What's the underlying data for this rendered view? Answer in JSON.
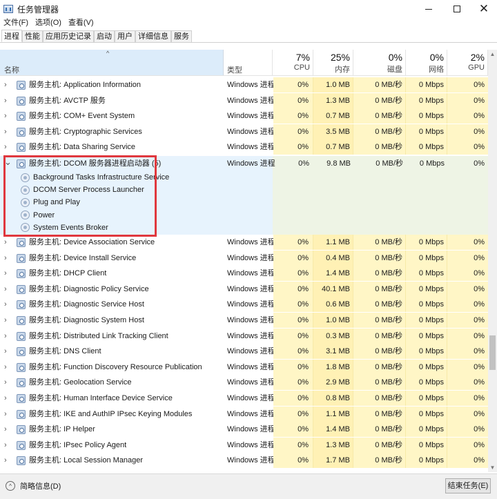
{
  "window": {
    "title": "任务管理器"
  },
  "menu": [
    "文件(F)",
    "选项(O)",
    "查看(V)"
  ],
  "tabs": [
    "进程",
    "性能",
    "应用历史记录",
    "启动",
    "用户",
    "详细信息",
    "服务"
  ],
  "header": {
    "name": "名称",
    "type": "类型",
    "columns": [
      {
        "pct": "7%",
        "label": "CPU"
      },
      {
        "pct": "25%",
        "label": "内存"
      },
      {
        "pct": "0%",
        "label": "磁盘"
      },
      {
        "pct": "0%",
        "label": "网络"
      },
      {
        "pct": "2%",
        "label": "GPU"
      }
    ]
  },
  "rows_top": [
    {
      "name": "服务主机: Application Information",
      "type": "Windows 进程",
      "cpu": "0%",
      "mem": "1.0 MB",
      "disk": "0 MB/秒",
      "net": "0 Mbps",
      "gpu": "0%"
    },
    {
      "name": "服务主机: AVCTP 服务",
      "type": "Windows 进程",
      "cpu": "0%",
      "mem": "1.3 MB",
      "disk": "0 MB/秒",
      "net": "0 Mbps",
      "gpu": "0%"
    },
    {
      "name": "服务主机: COM+ Event System",
      "type": "Windows 进程",
      "cpu": "0%",
      "mem": "0.7 MB",
      "disk": "0 MB/秒",
      "net": "0 Mbps",
      "gpu": "0%"
    },
    {
      "name": "服务主机: Cryptographic Services",
      "type": "Windows 进程",
      "cpu": "0%",
      "mem": "3.5 MB",
      "disk": "0 MB/秒",
      "net": "0 Mbps",
      "gpu": "0%"
    },
    {
      "name": "服务主机: Data Sharing Service",
      "type": "Windows 进程",
      "cpu": "0%",
      "mem": "0.7 MB",
      "disk": "0 MB/秒",
      "net": "0 Mbps",
      "gpu": "0%"
    }
  ],
  "group": {
    "name": "服务主机: DCOM 服务器进程启动器 (5)",
    "type": "Windows 进程",
    "cpu": "0%",
    "mem": "9.8 MB",
    "disk": "0 MB/秒",
    "net": "0 Mbps",
    "gpu": "0%",
    "children": [
      "Background Tasks Infrastructure Service",
      "DCOM Server Process Launcher",
      "Plug and Play",
      "Power",
      "System Events Broker"
    ]
  },
  "rows_bottom": [
    {
      "name": "服务主机: Device Association Service",
      "type": "Windows 进程",
      "cpu": "0%",
      "mem": "1.1 MB",
      "disk": "0 MB/秒",
      "net": "0 Mbps",
      "gpu": "0%"
    },
    {
      "name": "服务主机: Device Install Service",
      "type": "Windows 进程",
      "cpu": "0%",
      "mem": "0.4 MB",
      "disk": "0 MB/秒",
      "net": "0 Mbps",
      "gpu": "0%"
    },
    {
      "name": "服务主机: DHCP Client",
      "type": "Windows 进程",
      "cpu": "0%",
      "mem": "1.4 MB",
      "disk": "0 MB/秒",
      "net": "0 Mbps",
      "gpu": "0%"
    },
    {
      "name": "服务主机: Diagnostic Policy Service",
      "type": "Windows 进程",
      "cpu": "0%",
      "mem": "40.1 MB",
      "disk": "0 MB/秒",
      "net": "0 Mbps",
      "gpu": "0%"
    },
    {
      "name": "服务主机: Diagnostic Service Host",
      "type": "Windows 进程",
      "cpu": "0%",
      "mem": "0.6 MB",
      "disk": "0 MB/秒",
      "net": "0 Mbps",
      "gpu": "0%"
    },
    {
      "name": "服务主机: Diagnostic System Host",
      "type": "Windows 进程",
      "cpu": "0%",
      "mem": "1.0 MB",
      "disk": "0 MB/秒",
      "net": "0 Mbps",
      "gpu": "0%"
    },
    {
      "name": "服务主机: Distributed Link Tracking Client",
      "type": "Windows 进程",
      "cpu": "0%",
      "mem": "0.3 MB",
      "disk": "0 MB/秒",
      "net": "0 Mbps",
      "gpu": "0%"
    },
    {
      "name": "服务主机: DNS Client",
      "type": "Windows 进程",
      "cpu": "0%",
      "mem": "3.1 MB",
      "disk": "0 MB/秒",
      "net": "0 Mbps",
      "gpu": "0%"
    },
    {
      "name": "服务主机: Function Discovery Resource Publication",
      "type": "Windows 进程",
      "cpu": "0%",
      "mem": "1.8 MB",
      "disk": "0 MB/秒",
      "net": "0 Mbps",
      "gpu": "0%"
    },
    {
      "name": "服务主机: Geolocation Service",
      "type": "Windows 进程",
      "cpu": "0%",
      "mem": "2.9 MB",
      "disk": "0 MB/秒",
      "net": "0 Mbps",
      "gpu": "0%"
    },
    {
      "name": "服务主机: Human Interface Device Service",
      "type": "Windows 进程",
      "cpu": "0%",
      "mem": "0.8 MB",
      "disk": "0 MB/秒",
      "net": "0 Mbps",
      "gpu": "0%"
    },
    {
      "name": "服务主机: IKE and AuthIP IPsec Keying Modules",
      "type": "Windows 进程",
      "cpu": "0%",
      "mem": "1.1 MB",
      "disk": "0 MB/秒",
      "net": "0 Mbps",
      "gpu": "0%"
    },
    {
      "name": "服务主机: IP Helper",
      "type": "Windows 进程",
      "cpu": "0%",
      "mem": "1.4 MB",
      "disk": "0 MB/秒",
      "net": "0 Mbps",
      "gpu": "0%"
    },
    {
      "name": "服务主机: IPsec Policy Agent",
      "type": "Windows 进程",
      "cpu": "0%",
      "mem": "1.3 MB",
      "disk": "0 MB/秒",
      "net": "0 Mbps",
      "gpu": "0%"
    },
    {
      "name": "服务主机: Local Session Manager",
      "type": "Windows 进程",
      "cpu": "0%",
      "mem": "1.7 MB",
      "disk": "0 MB/秒",
      "net": "0 Mbps",
      "gpu": "0%"
    }
  ],
  "footer": {
    "fewer_details": "简略信息(D)",
    "end_task": "结束任务(E)"
  },
  "colors": {
    "highlight": "#e0383e",
    "selected_header": "#dcecfa",
    "heat": "#fff6c6"
  }
}
